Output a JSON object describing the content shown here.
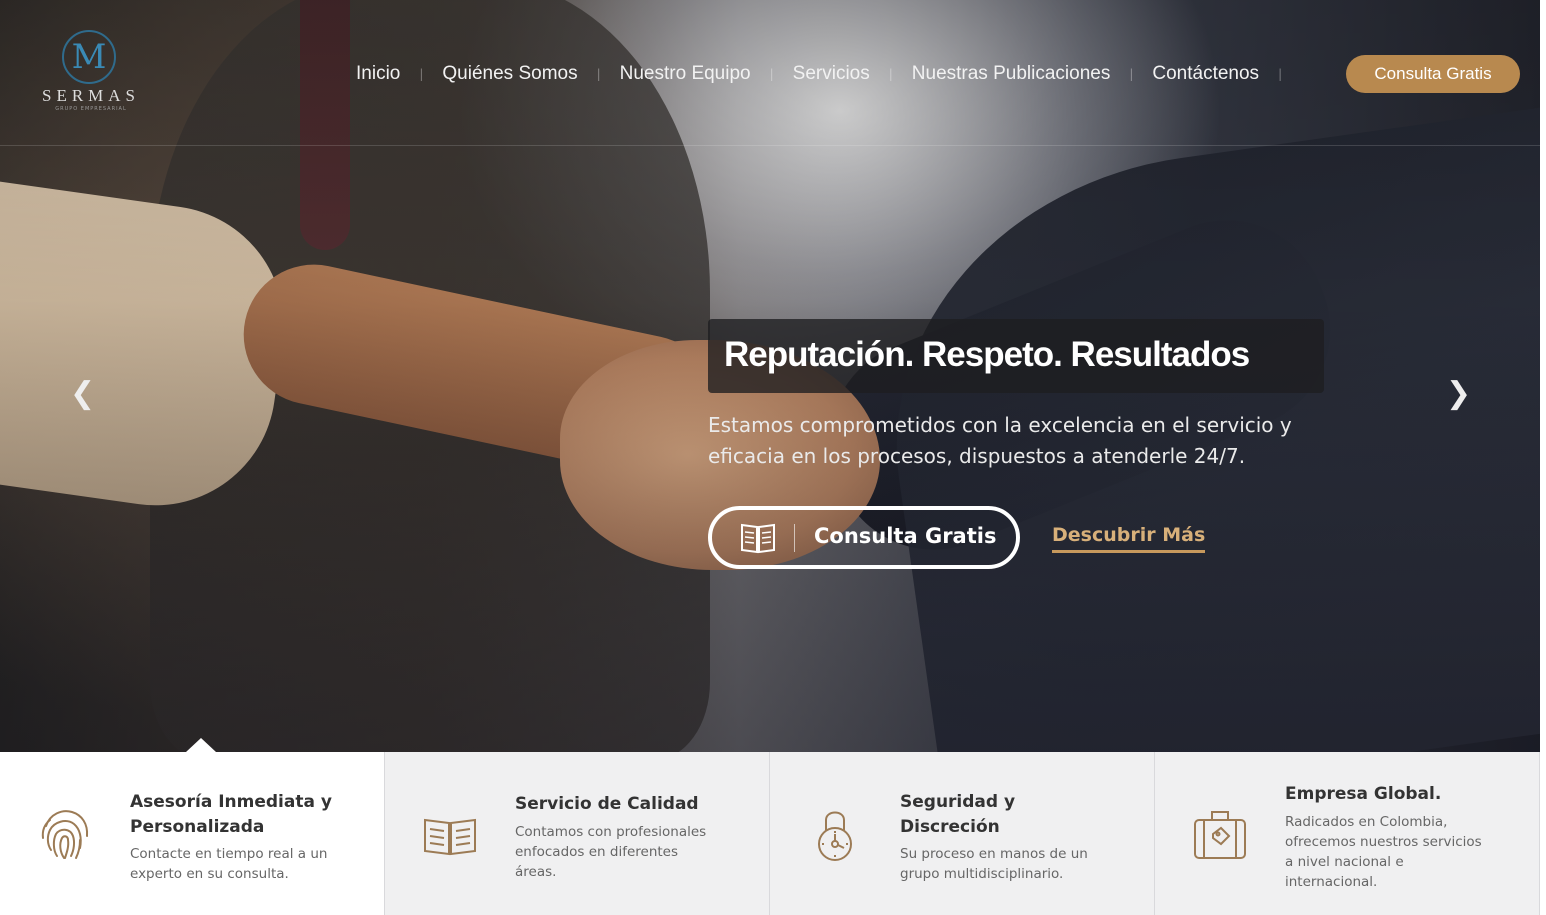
{
  "brand": {
    "logo_text": "SERMAS",
    "logo_tagline": "GRUPO EMPRESARIAL"
  },
  "nav": {
    "items": [
      {
        "label": "Inicio"
      },
      {
        "label": "Quiénes Somos"
      },
      {
        "label": "Nuestro Equipo"
      },
      {
        "label": "Servicios"
      },
      {
        "label": "Nuestras Publicaciones"
      },
      {
        "label": "Contáctenos"
      }
    ],
    "cta_label": "Consulta Gratis"
  },
  "hero": {
    "headline": "Reputación. Respeto. Resultados",
    "subtext": "Estamos comprometidos con la excelencia en el servicio y eficacia en los procesos, dispuestos a atenderle 24/7.",
    "primary_cta": "Consulta Gratis",
    "secondary_cta": "Descubrir Más",
    "prev_icon": "chevron-left-icon",
    "next_icon": "chevron-right-icon"
  },
  "features": [
    {
      "title": "Asesoría Inmediata y Personalizada",
      "description": "Contacte en tiempo real a un experto en su consulta.",
      "icon": "fingerprint-icon"
    },
    {
      "title": "Servicio de Calidad",
      "description": "Contamos con profesionales enfocados en diferentes áreas.",
      "icon": "book-icon"
    },
    {
      "title": "Seguridad y Discreción",
      "description": "Su proceso en manos de un grupo multidisciplinario.",
      "icon": "padlock-icon"
    },
    {
      "title": "Empresa Global.",
      "description": "Radicados en Colombia, ofrecemos nuestros servicios a nivel nacional e internacional.",
      "icon": "briefcase-icon"
    }
  ],
  "colors": {
    "accent": "#b8894f",
    "link_accent": "#d8b07a",
    "feature_bg": "#f0f0f1",
    "icon_color": "#9c7b55"
  }
}
